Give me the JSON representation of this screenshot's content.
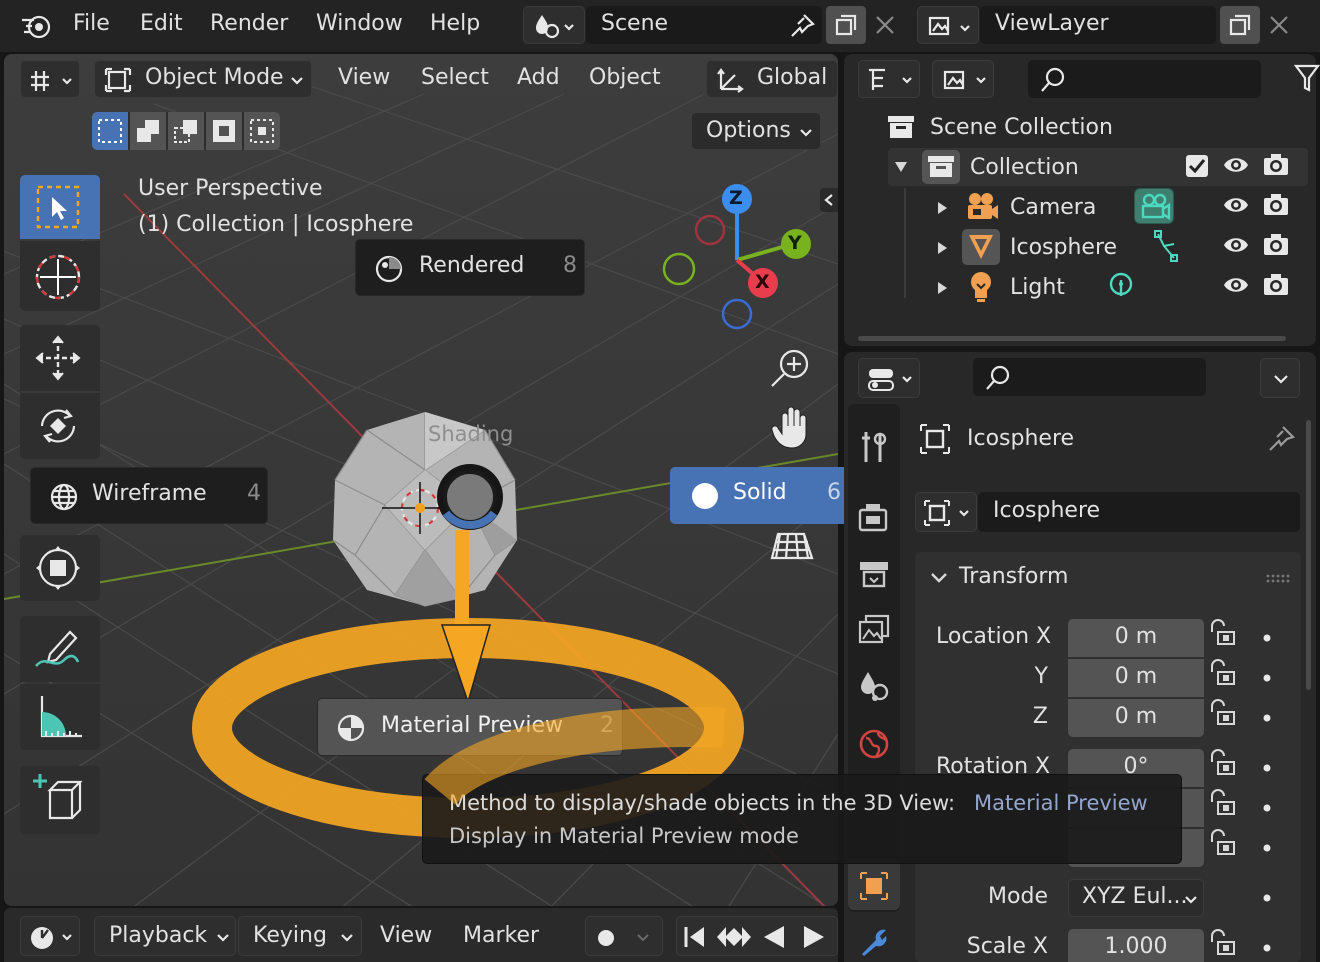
{
  "topbar": {
    "menus": [
      "File",
      "Edit",
      "Render",
      "Window",
      "Help"
    ],
    "scene": "Scene",
    "view_layer": "ViewLayer"
  },
  "viewport_header": {
    "mode": "Object Mode",
    "menus": [
      "View",
      "Select",
      "Add",
      "Object"
    ],
    "transform_orientation": "Global",
    "options": "Options"
  },
  "viewport": {
    "perspective": "User Perspective",
    "context": "(1) Collection | Icosphere",
    "pie_title": "Shading",
    "pie": {
      "rendered": {
        "label": "Rendered",
        "key": "8"
      },
      "wireframe": {
        "label": "Wireframe",
        "key": "4"
      },
      "solid": {
        "label": "Solid",
        "key": "6"
      },
      "material": {
        "label": "Material Preview",
        "key": "2"
      }
    },
    "gizmo": {
      "z": "Z",
      "y": "Y",
      "x": "X"
    },
    "tooltip": {
      "line1": "Method to display/shade objects in the 3D View:",
      "line1_value": "Material Preview",
      "line2": "Display in Material Preview mode"
    },
    "accent_color": "#f5a623"
  },
  "outliner": {
    "root": "Scene Collection",
    "collection": "Collection",
    "items": [
      "Camera",
      "Icosphere",
      "Light"
    ]
  },
  "properties": {
    "object_name": "Icosphere",
    "data_name": "Icosphere",
    "panel": "Transform",
    "location_label": "Location X",
    "axis_y": "Y",
    "axis_z": "Z",
    "loc_x": "0 m",
    "loc_y": "0 m",
    "loc_z": "0 m",
    "rotation_label": "Rotation X",
    "rot_x": "0°",
    "mode_label": "Mode",
    "mode_value": "XYZ Eul...",
    "scale_label": "Scale X",
    "scale_x": "1.000"
  },
  "timeline": {
    "menus": [
      "Playback",
      "Keying",
      "View",
      "Marker"
    ]
  }
}
